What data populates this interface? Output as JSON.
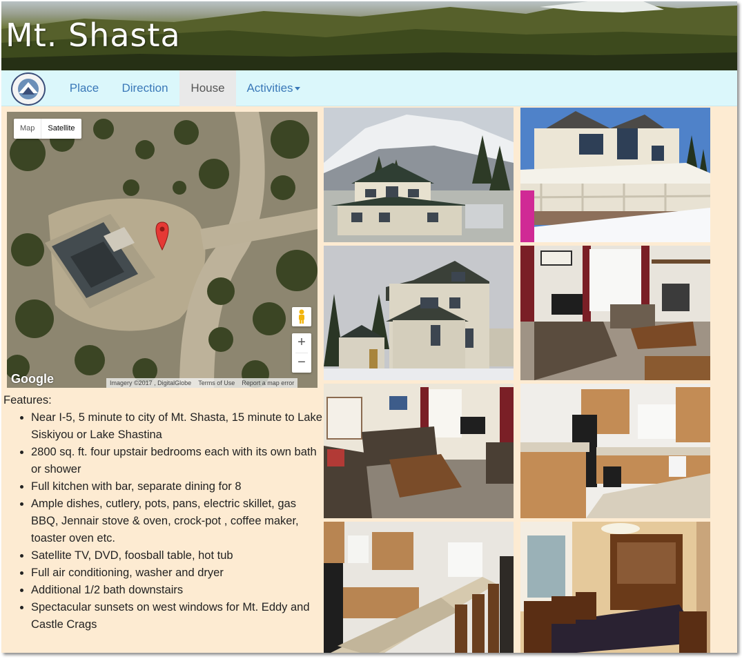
{
  "banner": {
    "title": "Mt. Shasta"
  },
  "nav": {
    "logo_name": "site-logo",
    "items": [
      {
        "label": "Place",
        "active": false
      },
      {
        "label": "Direction",
        "active": false
      },
      {
        "label": "House",
        "active": true
      },
      {
        "label": "Activities",
        "active": false,
        "dropdown": true
      }
    ]
  },
  "map": {
    "type_buttons": [
      "Map",
      "Satellite"
    ],
    "selected_type": "Satellite",
    "zoom_in": "+",
    "zoom_out": "−",
    "logo": "Google",
    "attribution": "Imagery ©2017 , DigitalGlobe",
    "terms": "Terms of Use",
    "report": "Report a map error",
    "marker_icon": "map-pin-icon",
    "pegman_icon": "street-view-icon"
  },
  "features": {
    "heading": "Features:",
    "items": [
      "Near I-5, 5 minute to city of Mt. Shasta, 15 minute to Lake Siskiyou or Lake Shastina",
      "2800 sq. ft. four upstair bedrooms each with its own bath or shower",
      "Full kitchen with bar, separate dining for 8",
      "Ample dishes, cutlery, pots, pans, electric skillet, gas BBQ, Jennair stove & oven, crock-pot , coffee maker, toaster oven etc.",
      "Satellite TV, DVD, foosball table, hot tub",
      "Full air conditioning, washer and dryer",
      "Additional 1/2 bath downstairs",
      "Spectacular sunsets on west windows for Mt. Eddy and Castle Crags"
    ]
  },
  "photos": [
    "house-exterior-mountain-photo",
    "house-porch-snow-photo",
    "house-side-view-photo",
    "living-room-fireplace-photo",
    "living-room-sofa-photo",
    "kitchen-photo",
    "kitchen-bar-photo",
    "dining-room-photo"
  ],
  "colors": {
    "page_bg": "#fdebd2",
    "navbar_bg": "#dbf7fb",
    "nav_link": "#3a78b8",
    "nav_active_bg": "#e9e9e9"
  }
}
